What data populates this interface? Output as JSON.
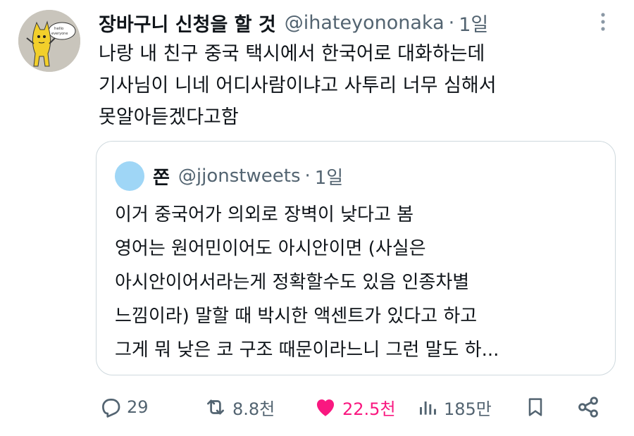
{
  "tweet": {
    "display_name": "장바구니 신청을 할 것",
    "handle": "@ihateyononaka",
    "separator": "·",
    "time": "1일",
    "lines": [
      "나랑 내 친구 중국 택시에서 한국어로 대화하는데",
      "기사님이 니네 어디사람이냐고 사투리 너무 심해서",
      "못알아듣겠다고함"
    ]
  },
  "avatar": {
    "sign_text": "hello everyone"
  },
  "quote": {
    "display_name": "쫀",
    "handle": "@jjonstweets",
    "separator": "·",
    "time": "1일",
    "avatar_color": "#9fd6f6",
    "lines": [
      "이거 중국어가 의외로 장벽이 낮다고 봄",
      "영어는 원어민이어도 아시안이면 (사실은",
      "아시안이어서라는게 정확할수도 있음 인종차별",
      "느낌이라) 말할 때 박시한 액센트가 있다고 하고",
      "그게 뭐 낮은 코 구조 때문이라느니 그런 말도 하..."
    ]
  },
  "actions": {
    "reply_count": "29",
    "retweet_count": "8.8천",
    "like_count": "22.5천",
    "views_count": "185만"
  },
  "icons": {
    "reply": "reply-icon",
    "retweet": "retweet-icon",
    "like": "heart-icon",
    "views": "views-icon",
    "bookmark": "bookmark-icon",
    "share": "share-icon",
    "more": "more-icon"
  },
  "colors": {
    "like": "#f91880",
    "muted": "#536471",
    "text": "#0f1419",
    "border": "#cfd9de"
  }
}
